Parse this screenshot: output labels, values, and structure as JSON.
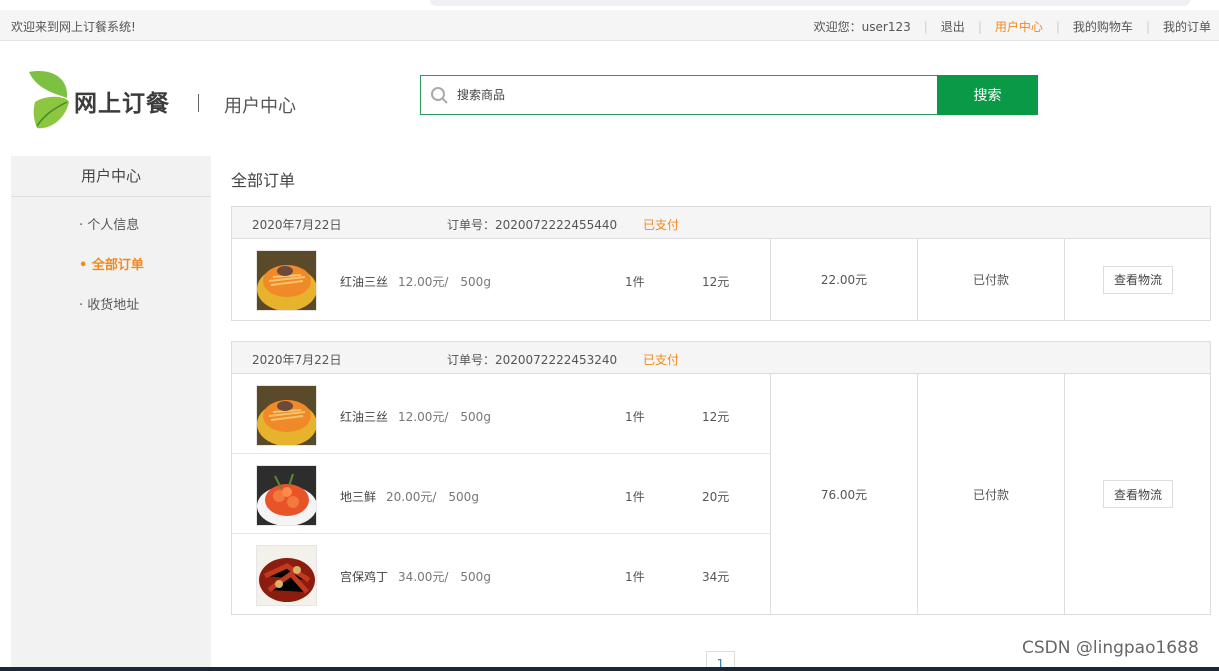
{
  "topbar": {
    "welcome": "欢迎来到网上订餐系统!",
    "user_greeting": "欢迎您：user123",
    "logout": "退出",
    "user_center": "用户中心",
    "cart": "我的购物车",
    "orders": "我的订单"
  },
  "header": {
    "logo_text": "网上订餐",
    "divider": "|",
    "subtitle": "用户中心",
    "search_placeholder": "搜索商品",
    "search_button": "搜索"
  },
  "sidebar": {
    "title": "用户中心",
    "items": [
      {
        "label": "· 个人信息"
      },
      {
        "label": "• 全部订单"
      },
      {
        "label": "· 收货地址"
      }
    ]
  },
  "main": {
    "title": "全部订单"
  },
  "orders": [
    {
      "date": "2020年7月22日",
      "order_no": "订单号：2020072222455440",
      "status": "已支付",
      "items": [
        {
          "name": "红油三丝",
          "price": "12.00元/　500g",
          "qty": "1件",
          "subtotal": "12元",
          "thumb": "noodles"
        }
      ],
      "total": "22.00元",
      "pay_status": "已付款",
      "action": "查看物流"
    },
    {
      "date": "2020年7月22日",
      "order_no": "订单号：2020072222453240",
      "status": "已支付",
      "items": [
        {
          "name": "红油三丝",
          "price": "12.00元/　500g",
          "qty": "1件",
          "subtotal": "12元",
          "thumb": "noodles"
        },
        {
          "name": "地三鲜",
          "price": "20.00元/　500g",
          "qty": "1件",
          "subtotal": "20元",
          "thumb": "shrimp"
        },
        {
          "name": "宫保鸡丁",
          "price": "34.00元/　500g",
          "qty": "1件",
          "subtotal": "34元",
          "thumb": "chicken"
        }
      ],
      "total": "76.00元",
      "pay_status": "已付款",
      "action": "查看物流"
    }
  ],
  "pager": {
    "current": "1"
  },
  "watermark": "CSDN @lingpao1688",
  "colors": {
    "brand_green": "#0a9a47",
    "accent_orange": "#f08a1e"
  }
}
